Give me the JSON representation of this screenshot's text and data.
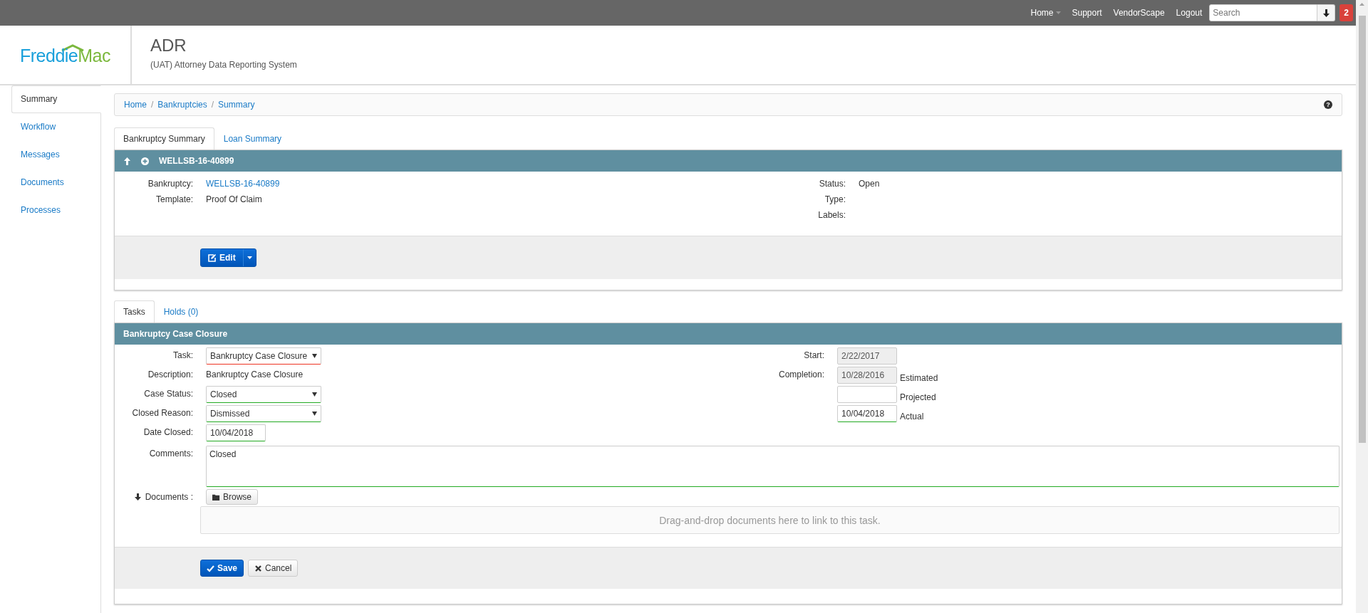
{
  "top_nav": {
    "items": [
      {
        "label": "Home",
        "dropdown": true
      },
      {
        "label": "Support",
        "dropdown": false
      },
      {
        "label": "VendorScape",
        "dropdown": false
      },
      {
        "label": "Logout",
        "dropdown": false
      }
    ],
    "search": {
      "placeholder": "Search"
    },
    "notifications": "2"
  },
  "header": {
    "logo": {
      "word_1": "Freddie",
      "word_2": "Mac"
    },
    "title": "ADR",
    "subtitle": "(UAT) Attorney Data Reporting System"
  },
  "sidebar": {
    "items": [
      {
        "label": "Summary",
        "selected": true
      },
      {
        "label": "Workflow",
        "selected": false
      },
      {
        "label": "Messages",
        "selected": false
      },
      {
        "label": "Documents",
        "selected": false
      },
      {
        "label": "Processes",
        "selected": false
      }
    ]
  },
  "breadcrumb": {
    "items": [
      "Home",
      "Bankruptcies",
      "Summary"
    ],
    "separator": "/",
    "help": "?"
  },
  "summary_tabs": [
    {
      "label": "Bankruptcy Summary",
      "selected": true
    },
    {
      "label": "Loan Summary",
      "selected": false
    }
  ],
  "summary_panel": {
    "title": "WELLSB-16-40899",
    "left_fields": [
      {
        "label": "Bankruptcy:",
        "value": "WELLSB-16-40899",
        "kind": "link"
      },
      {
        "label": "Template:",
        "value": "Proof Of Claim",
        "kind": "text"
      }
    ],
    "right_fields": [
      {
        "label": "Status:",
        "value": "Open",
        "kind": "text"
      },
      {
        "label": "Type:"
      },
      {
        "label": "Labels:"
      }
    ],
    "edit_button": "Edit"
  },
  "task_tabs": [
    {
      "label": "Tasks",
      "selected": true
    },
    {
      "label": "Holds (0)",
      "selected": false
    }
  ],
  "task_panel": {
    "title": "Bankruptcy Case Closure",
    "left_fields": [
      {
        "label": "Task:",
        "kind": "select",
        "value": "Bankruptcy Case Closure",
        "valid": false
      },
      {
        "label": "Description:",
        "kind": "text",
        "value": "Bankruptcy Case Closure"
      },
      {
        "label": "Case Status:",
        "kind": "select",
        "value": "Closed",
        "valid": true
      },
      {
        "label": "Closed Reason:",
        "kind": "select",
        "value": "Dismissed",
        "valid": true
      },
      {
        "label": "Date Closed:",
        "kind": "date",
        "value": "10/04/2018",
        "valid": true
      }
    ],
    "right_fields": [
      {
        "label": "Start:",
        "value": "2/22/2017",
        "disabled": true
      },
      {
        "label": "Completion:",
        "value": "10/28/2016",
        "note": "Estimated",
        "disabled": true
      },
      {
        "note": "Projected",
        "disabled": false
      },
      {
        "value": "10/04/2018",
        "note": "Actual",
        "disabled": false,
        "valid": true
      }
    ],
    "comments": {
      "label": "Comments:",
      "value": "Closed",
      "valid": true
    },
    "documents": {
      "label": "Documents :",
      "browse": "Browse",
      "dropzone": "Drag-and-drop documents here to link to this task."
    },
    "save": "Save",
    "cancel": "Cancel"
  }
}
